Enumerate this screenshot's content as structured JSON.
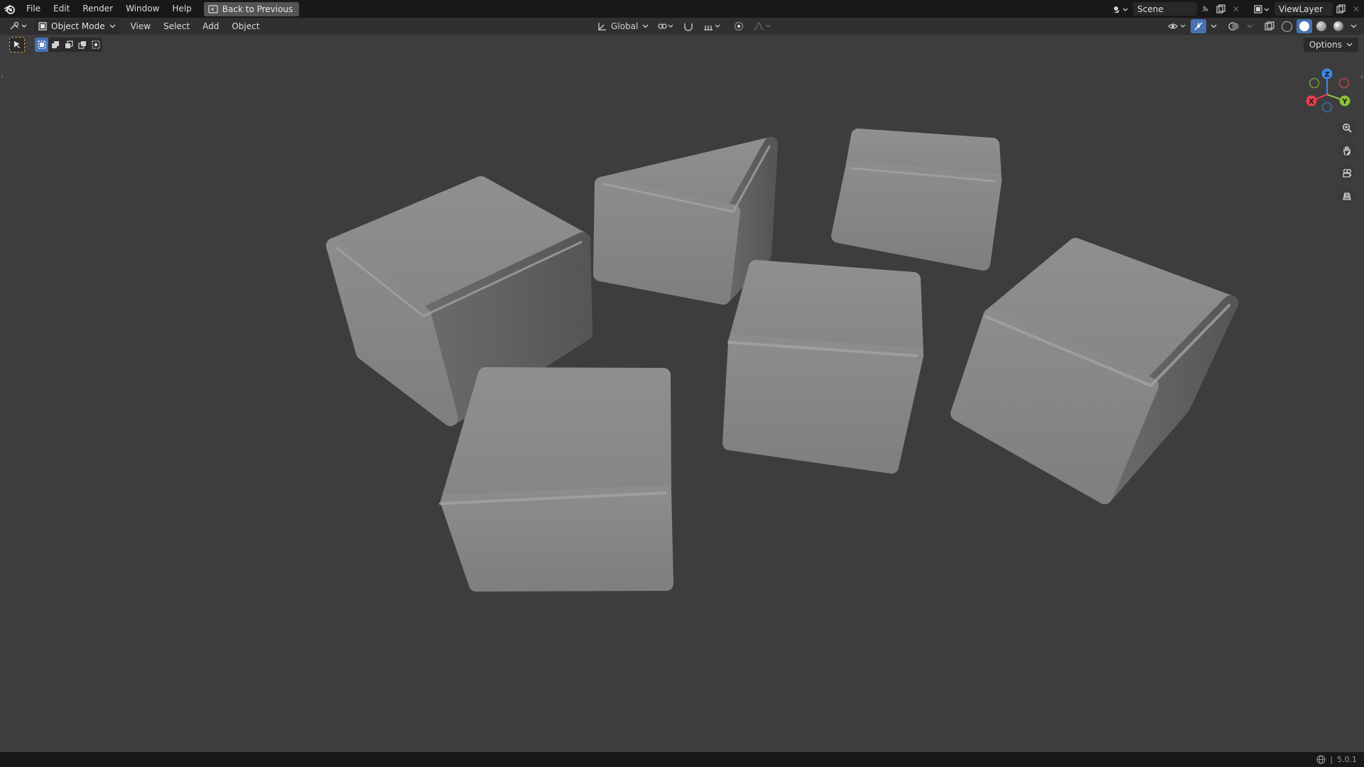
{
  "topbar": {
    "menus": [
      "File",
      "Edit",
      "Render",
      "Window",
      "Help"
    ],
    "back_button": "Back to Previous",
    "scene_name": "Scene",
    "view_layer": "ViewLayer"
  },
  "viewport_header": {
    "mode": "Object Mode",
    "menus": [
      "View",
      "Select",
      "Add",
      "Object"
    ],
    "transform_orientation": "Global",
    "options_label": "Options"
  },
  "gizmo": {
    "x_label": "X",
    "y_label": "Y",
    "z_label": "Z",
    "x_color": "#ee3a4f",
    "y_color": "#8ac33a",
    "z_color": "#3e88e6"
  },
  "icons": {
    "blender_logo": "blender-logo-icon",
    "back": "back-to-previous-icon",
    "scene": "scene-icon",
    "pin": "pin-icon",
    "new_scene": "new-scene-icon",
    "remove": "close-icon",
    "view_layer": "view-layer-icon",
    "editor_type": "editor-type-icon",
    "orientation": "transform-orientation-icon",
    "pivot": "pivot-point-icon",
    "snap": "snap-icon",
    "proportional": "proportional-editing-icon",
    "visibility": "object-visibility-icon",
    "gizmo_toggle": "gizmo-toggle-icon",
    "overlay": "overlay-icon",
    "xray": "xray-icon",
    "zoom": "zoom-icon",
    "pan": "pan-hand-icon",
    "camera": "camera-view-icon",
    "ortho": "orthographic-grid-icon",
    "language": "globe-icon"
  },
  "accent_color": "#4772b3",
  "status": {
    "version": "5.0.1"
  }
}
